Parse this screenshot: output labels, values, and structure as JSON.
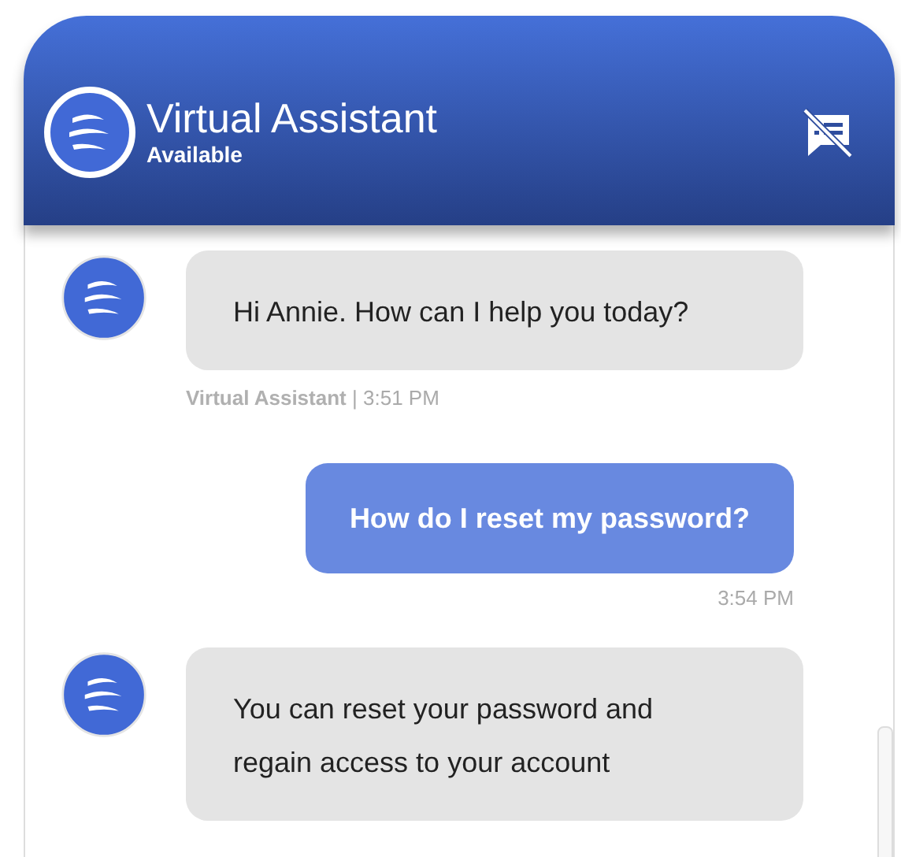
{
  "header": {
    "title": "Virtual Assistant",
    "status": "Available"
  },
  "messages": [
    {
      "kind": "bot",
      "text": "Hi Annie. How can I help you today?",
      "sender": "Virtual Assistant",
      "separator": "|",
      "time": "3:51 PM"
    },
    {
      "kind": "user",
      "text": "How do I reset my password?",
      "time": "3:54 PM"
    },
    {
      "kind": "bot",
      "text": "You can reset your password and regain access to your account"
    }
  ]
}
